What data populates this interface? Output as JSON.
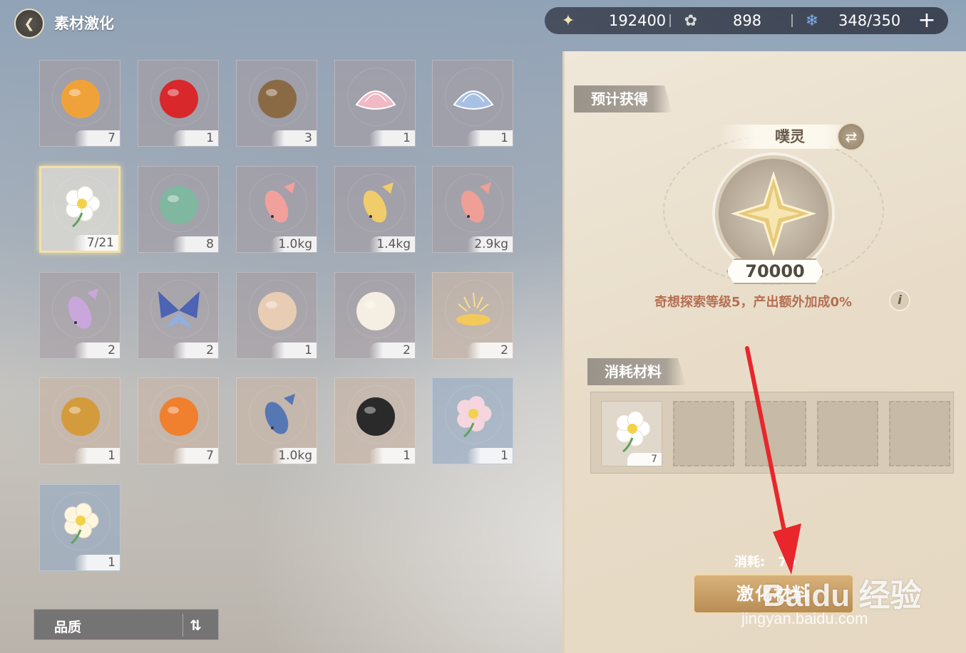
{
  "header": {
    "title": "素材激化",
    "back_icon": "back-arrow-icon"
  },
  "currencies": [
    {
      "icon": "star-gem-icon",
      "value": "192400"
    },
    {
      "icon": "ribbon-icon",
      "value": "898"
    },
    {
      "icon": "blue-flame-icon",
      "value": "348/350"
    }
  ],
  "plus_label": "+",
  "materials": [
    {
      "name": "orange-fruit",
      "count": "7",
      "color": "#f0a23a",
      "shape": "circle"
    },
    {
      "name": "red-pepper",
      "count": "1",
      "color": "#d8282c",
      "shape": "circle"
    },
    {
      "name": "pine-cone",
      "count": "3",
      "color": "#8a6a45",
      "shape": "circle"
    },
    {
      "name": "pink-shell",
      "count": "1",
      "color": "#f0b9c4",
      "shape": "shell"
    },
    {
      "name": "blue-shell",
      "count": "1",
      "color": "#a7c0e4",
      "shape": "shell"
    },
    {
      "name": "white-flower",
      "count": "7/21",
      "color": "#ffffff",
      "shape": "flower",
      "selected": true
    },
    {
      "name": "green-cabbage",
      "count": "8",
      "color": "#7fb7a0",
      "shape": "circle"
    },
    {
      "name": "pink-fish",
      "count": "1.0kg",
      "color": "#f2a09b",
      "shape": "fish"
    },
    {
      "name": "golden-fish",
      "count": "1.4kg",
      "color": "#f0cd6a",
      "shape": "fish"
    },
    {
      "name": "pink-fish-2",
      "count": "2.9kg",
      "color": "#ee9f96",
      "shape": "fish"
    },
    {
      "name": "purple-bird",
      "count": "2",
      "color": "#c9a6dc",
      "shape": "fish"
    },
    {
      "name": "blue-butterfly",
      "count": "2",
      "color": "#4d63b3",
      "shape": "butterfly"
    },
    {
      "name": "mushroom",
      "count": "1",
      "color": "#e8cdb4",
      "shape": "circle"
    },
    {
      "name": "white-snail",
      "count": "2",
      "color": "#f4efe2",
      "shape": "circle"
    },
    {
      "name": "golden-sparkle",
      "count": "2",
      "color": "#f3c95a",
      "shape": "sparkle",
      "warm": true
    },
    {
      "name": "acorn",
      "count": "1",
      "color": "#d49b3c",
      "shape": "circle",
      "warm": true
    },
    {
      "name": "orange-citrus",
      "count": "7",
      "color": "#f07f2e",
      "shape": "circle",
      "warm": true
    },
    {
      "name": "blue-fish",
      "count": "1.0kg",
      "color": "#5577b4",
      "shape": "fish",
      "warm": true
    },
    {
      "name": "bee",
      "count": "1",
      "color": "#2a2a2a",
      "shape": "circle",
      "warm": true
    },
    {
      "name": "pink-orchid",
      "count": "1",
      "color": "#f6d4e0",
      "shape": "flower",
      "blue": true
    },
    {
      "name": "white-blossom",
      "count": "1",
      "color": "#fff6df",
      "shape": "flower",
      "blue": true
    }
  ],
  "quality": {
    "label": "品质",
    "sort_icon": "sort-arrows-icon"
  },
  "result": {
    "section_title": "预计获得",
    "name": "噗灵",
    "swap_icon": "swap-icon",
    "amount": "70000",
    "bonus": "奇想探索等级5，产出额外加成0%",
    "info_icon": "i"
  },
  "consume": {
    "section_title": "消耗材料",
    "slots": [
      {
        "filled": true,
        "item": "white-flower",
        "count": "7"
      },
      {
        "filled": false
      },
      {
        "filled": false
      },
      {
        "filled": false
      },
      {
        "filled": false
      }
    ]
  },
  "cost": {
    "label": "消耗:",
    "value": "70"
  },
  "activate_button": "激化材料",
  "watermark": {
    "logo": "Baidu 经验",
    "url": "jingyan.baidu.com"
  },
  "arrow_color": "#e8262b"
}
